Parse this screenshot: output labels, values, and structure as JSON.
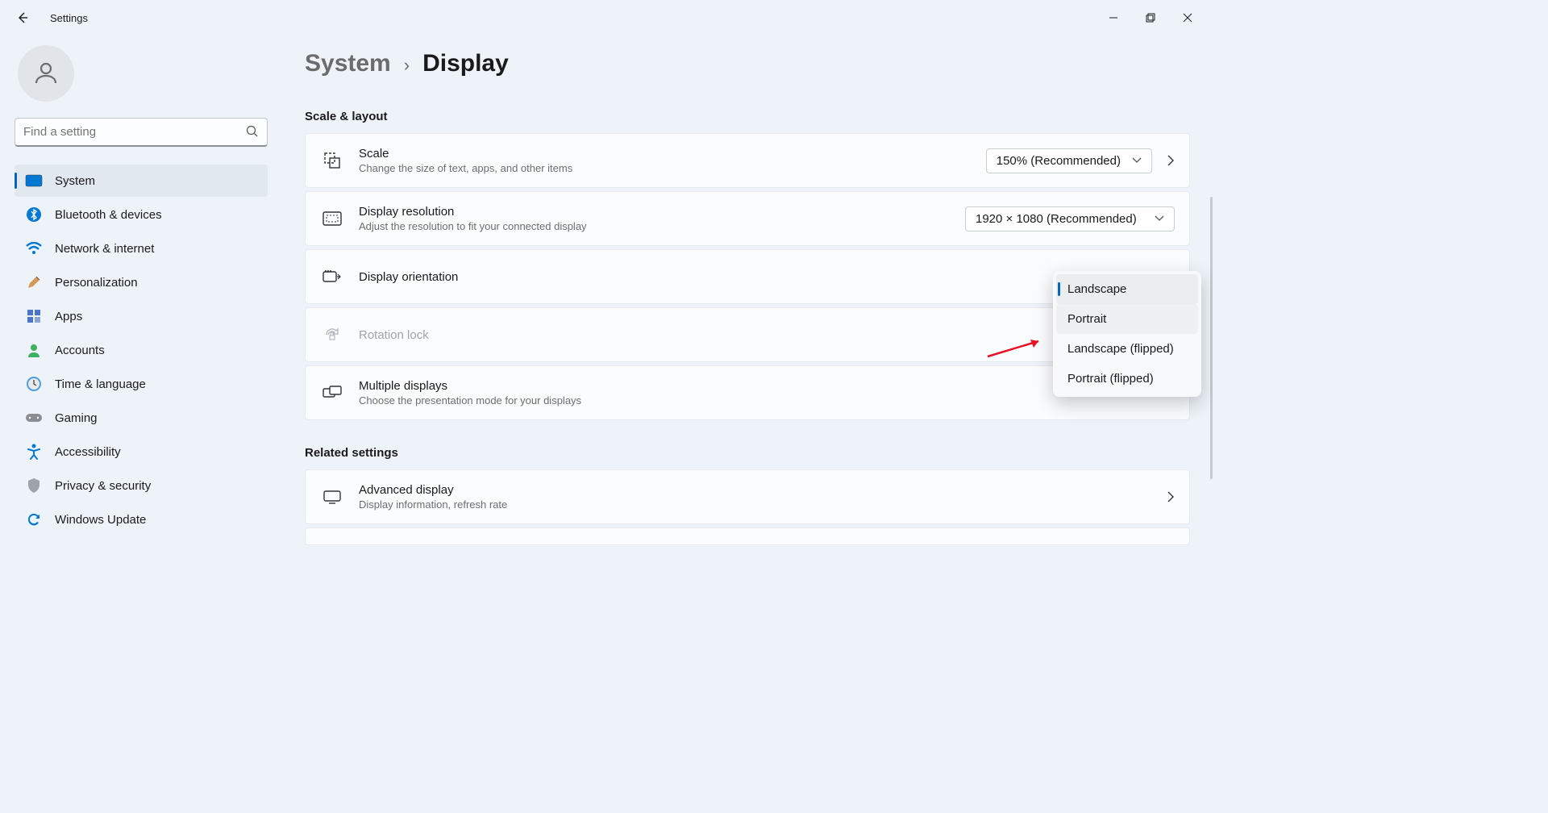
{
  "app": {
    "title": "Settings"
  },
  "search": {
    "placeholder": "Find a setting"
  },
  "sidebar": {
    "items": [
      {
        "label": "System",
        "icon": "system"
      },
      {
        "label": "Bluetooth & devices",
        "icon": "bluetooth"
      },
      {
        "label": "Network & internet",
        "icon": "wifi"
      },
      {
        "label": "Personalization",
        "icon": "brush"
      },
      {
        "label": "Apps",
        "icon": "apps"
      },
      {
        "label": "Accounts",
        "icon": "account"
      },
      {
        "label": "Time & language",
        "icon": "clock"
      },
      {
        "label": "Gaming",
        "icon": "gaming"
      },
      {
        "label": "Accessibility",
        "icon": "accessibility"
      },
      {
        "label": "Privacy & security",
        "icon": "shield"
      },
      {
        "label": "Windows Update",
        "icon": "update"
      }
    ]
  },
  "breadcrumb": {
    "parent": "System",
    "current": "Display"
  },
  "sections": {
    "scale_layout": "Scale & layout",
    "related": "Related settings"
  },
  "cards": {
    "scale": {
      "title": "Scale",
      "sub": "Change the size of text, apps, and other items",
      "value": "150% (Recommended)"
    },
    "resolution": {
      "title": "Display resolution",
      "sub": "Adjust the resolution to fit your connected display",
      "value": "1920 × 1080 (Recommended)"
    },
    "orientation": {
      "title": "Display orientation"
    },
    "rotation": {
      "title": "Rotation lock"
    },
    "multiple": {
      "title": "Multiple displays",
      "sub": "Choose the presentation mode for your displays"
    },
    "advanced": {
      "title": "Advanced display",
      "sub": "Display information, refresh rate"
    }
  },
  "dropdown": {
    "options": [
      {
        "label": "Landscape"
      },
      {
        "label": "Portrait"
      },
      {
        "label": "Landscape (flipped)"
      },
      {
        "label": "Portrait (flipped)"
      }
    ]
  }
}
